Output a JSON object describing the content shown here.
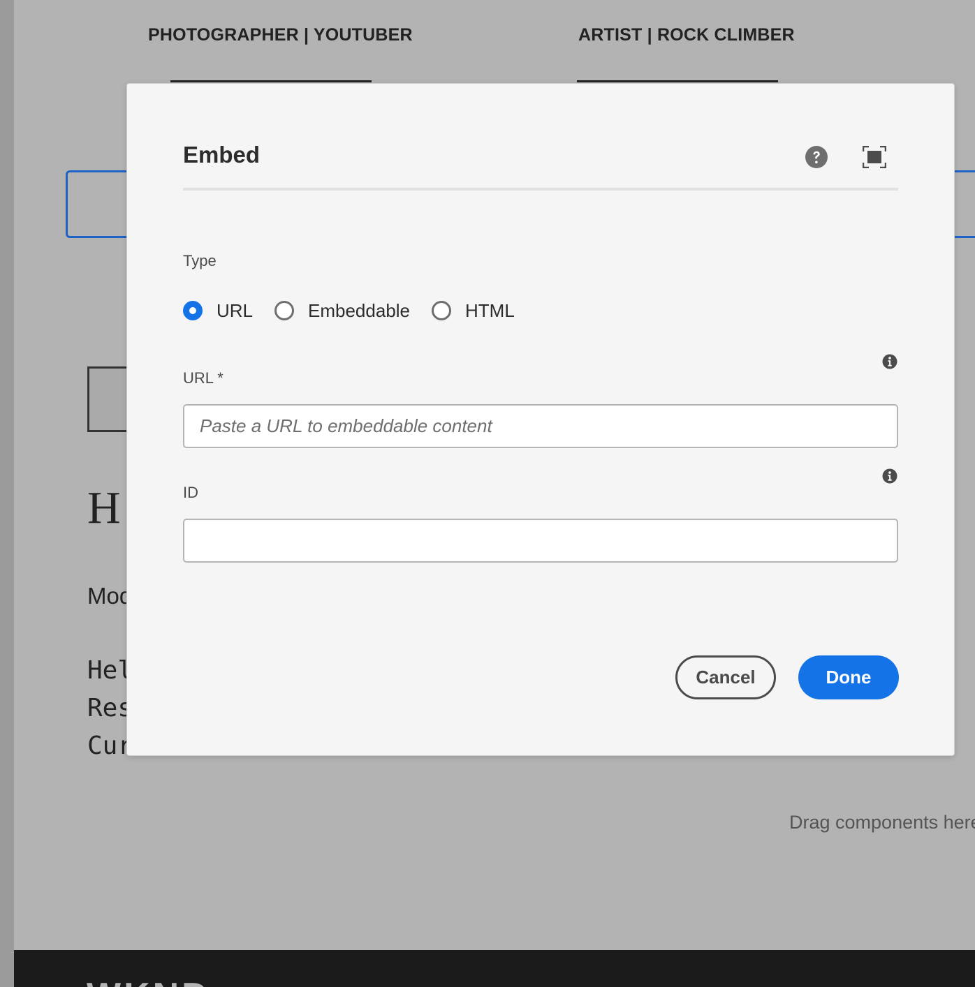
{
  "background": {
    "cards": [
      {
        "role": "PHOTOGRAPHER | YOUTUBER"
      },
      {
        "role": "ARTIST | ROCK CLIMBER"
      }
    ],
    "drag_hint": "Drag components here"
  },
  "dialog": {
    "title": "Embed",
    "type_label": "Type",
    "type_options": [
      {
        "label": "URL",
        "selected": true
      },
      {
        "label": "Embeddable",
        "selected": false
      },
      {
        "label": "HTML",
        "selected": false
      }
    ],
    "url_label": "URL *",
    "url_placeholder": "Paste a URL to embeddable content",
    "url_value": "",
    "id_label": "ID",
    "id_value": "",
    "cancel_label": "Cancel",
    "done_label": "Done"
  },
  "colors": {
    "accent": "#1473e6",
    "overlay": "#b3b3b3",
    "dialog_bg": "#f5f5f5"
  },
  "icons": {
    "help": "help-icon",
    "fullscreen": "fullscreen-icon",
    "info": "info-icon"
  }
}
